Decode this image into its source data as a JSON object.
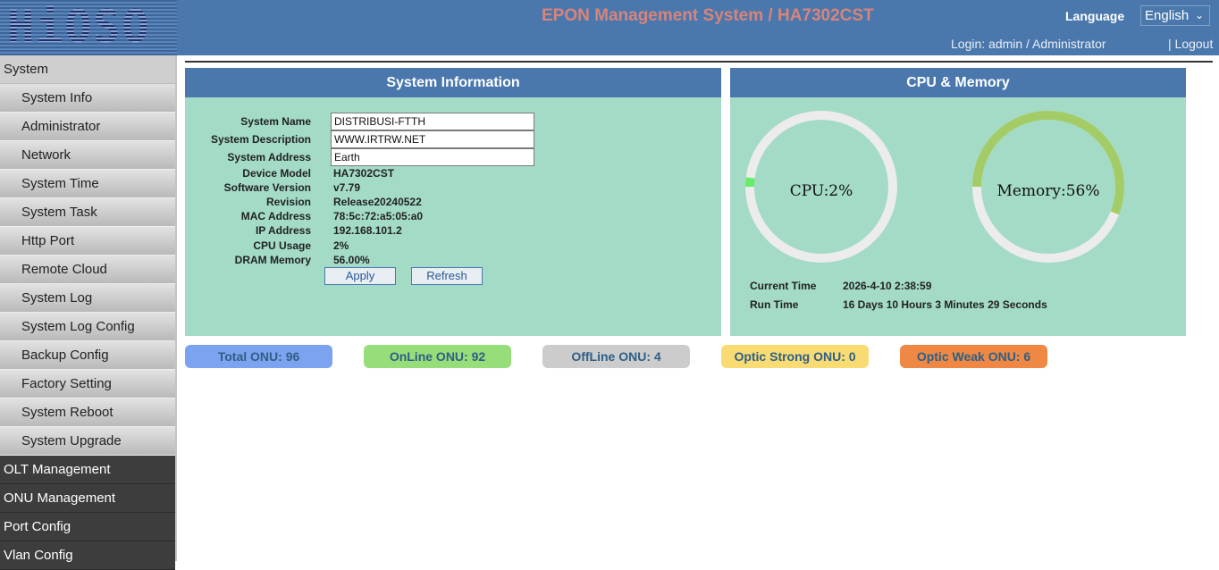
{
  "header": {
    "logo_text": "HiOSO",
    "title": "EPON Management System / HA7302CST",
    "language_label": "Language",
    "language_value": "English",
    "login_info": "Login: admin / Administrator",
    "logout": "| Logout"
  },
  "sidebar": {
    "system": "System",
    "sub_items": [
      "System Info",
      "Administrator",
      "Network",
      "System Time",
      "System Task",
      "Http Port",
      "Remote Cloud",
      "System Log",
      "System Log Config",
      "Backup Config",
      "Factory Setting",
      "System Reboot",
      "System Upgrade"
    ],
    "top_items": [
      "OLT Management",
      "ONU Management",
      "Port Config",
      "Vlan Config"
    ]
  },
  "sysinfo": {
    "title": "System Information",
    "labels": {
      "name": "System Name",
      "description": "System Description",
      "address": "System Address",
      "model": "Device Model",
      "software": "Software Version",
      "revision": "Revision",
      "mac": "MAC Address",
      "ip": "IP Address",
      "cpu": "CPU Usage",
      "dram": "DRAM Memory"
    },
    "values": {
      "name": "DISTRIBUSI-FTTH",
      "description": "WWW.IRTRW.NET",
      "address": "Earth",
      "model": "HA7302CST",
      "software": "v7.79",
      "revision": "Release20240522",
      "mac": "78:5c:72:a5:05:a0",
      "ip": "192.168.101.2",
      "cpu": "2%",
      "dram": "56.00%"
    },
    "apply": "Apply",
    "refresh": "Refresh"
  },
  "cpumem": {
    "title": "CPU & Memory",
    "cpu_label": "CPU:2%",
    "cpu_percent": 2,
    "mem_label": "Memory:56%",
    "mem_percent": 56,
    "current_time_label": "Current Time",
    "current_time": "2026-4-10 2:38:59",
    "run_time_label": "Run Time",
    "run_time": "16 Days 10 Hours 3 Minutes 29 Seconds"
  },
  "onu_stats": {
    "total": "Total ONU:  96",
    "online": "OnLine ONU:  92",
    "offline": "OffLine ONU:  4",
    "strong": "Optic Strong ONU:  0",
    "weak": "Optic Weak ONU:  6"
  },
  "colors": {
    "header": "#4a78ad",
    "panel": "#a3dbc6",
    "cpu_arc": "#66ee66",
    "mem_arc": "#a4cc66",
    "badge_total": "#7ba3ef",
    "badge_online": "#95de79",
    "badge_offline": "#cccccc",
    "badge_strong": "#f8dc73",
    "badge_weak": "#ee8844"
  }
}
